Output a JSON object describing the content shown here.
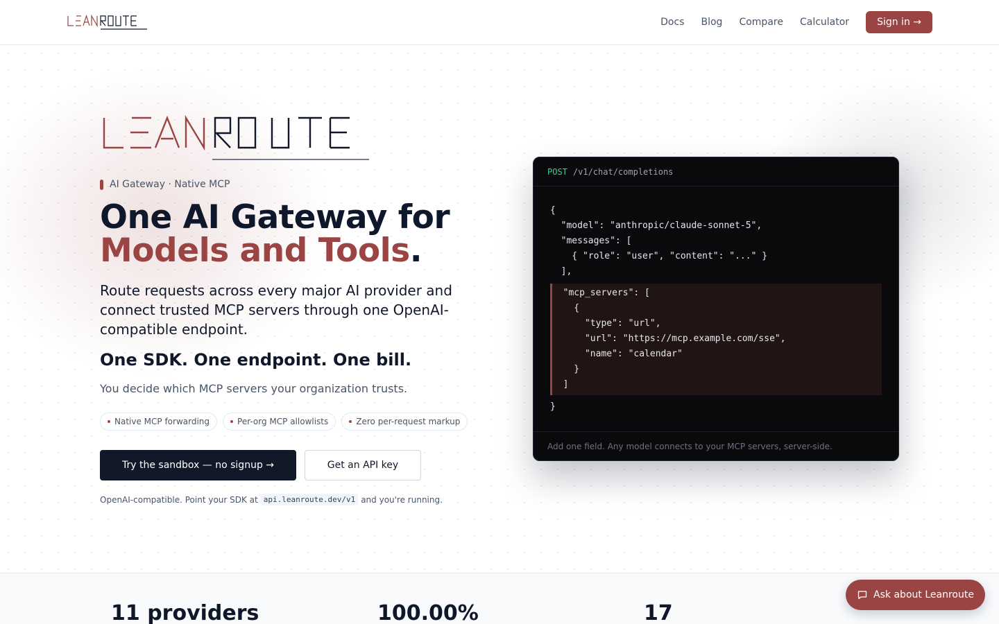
{
  "brand": {
    "name_part1": "LEAN",
    "name_part2": "ROUTE"
  },
  "nav": {
    "links": [
      "Docs",
      "Blog",
      "Compare",
      "Calculator"
    ],
    "signin_label": "Sign in →"
  },
  "hero": {
    "tag": "AI Gateway · Native MCP",
    "headline_line1": "One AI Gateway for",
    "headline_accent": "Models and Tools",
    "headline_period": ".",
    "lead": "Route requests across every major AI provider and connect trusted MCP servers through one OpenAI-compatible endpoint.",
    "tagline": "One SDK. One endpoint. One bill.",
    "subtext": "You decide which MCP servers your organization trusts.",
    "pills": [
      "Native MCP forwarding",
      "Per-org MCP allowlists",
      "Zero per-request markup"
    ],
    "cta_primary": "Try the sandbox — no signup →",
    "cta_secondary": "Get an API key",
    "compat_before": "OpenAI-compatible. Point your SDK at",
    "compat_code": "api.leanroute.dev/v1",
    "compat_after": "and you're running."
  },
  "code": {
    "method": "POST",
    "path": "/v1/chat/completions",
    "lines_top": [
      "{",
      "  \"model\": \"anthropic/claude-sonnet-5\",",
      "  \"messages\": [",
      "    { \"role\": \"user\", \"content\": \"...\" }",
      "  ],"
    ],
    "lines_highlight": [
      "  \"mcp_servers\": [",
      "    {",
      "      \"type\": \"url\",",
      "      \"url\": \"https://mcp.example.com/sse\",",
      "      \"name\": \"calendar\"",
      "    }",
      "  ]"
    ],
    "lines_bottom": [
      "}"
    ],
    "footer": "Add one field. Any model connects to your MCP servers, server-side."
  },
  "stats": [
    "11 providers",
    "100.00%",
    "17"
  ],
  "chat_widget": {
    "label": "Ask about Leanroute"
  },
  "colors": {
    "accent": "#9b4444",
    "dark": "#0f172a",
    "code_bg": "#0a0a0c"
  },
  "icons": [
    "chat-bubble-icon"
  ]
}
